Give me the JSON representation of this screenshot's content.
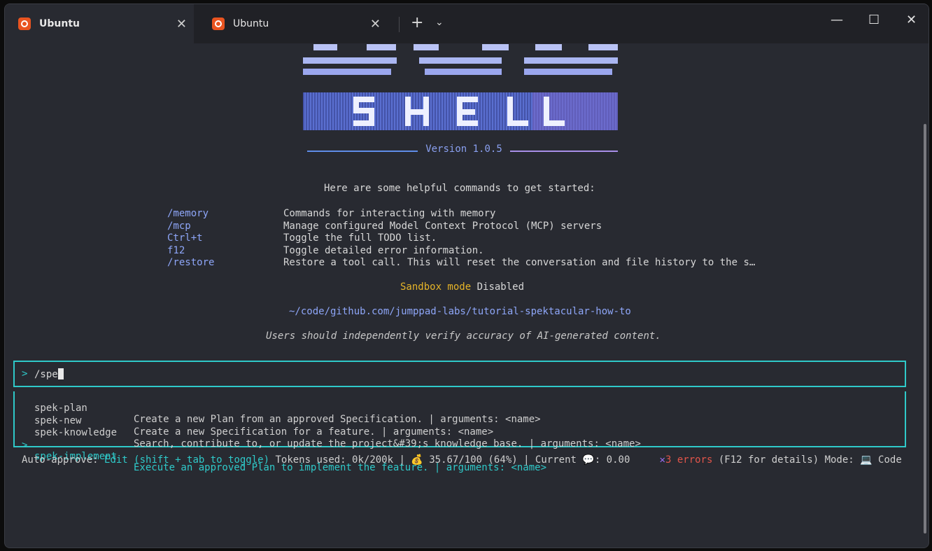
{
  "tabs": [
    {
      "label": "Ubuntu",
      "icon": "ubuntu-icon"
    },
    {
      "label": "Ubuntu",
      "icon": "ubuntu-icon"
    }
  ],
  "window_controls": {
    "new_tab": "+",
    "dropdown": "⌄",
    "minimize": "—",
    "maximize": "☐",
    "close": "✕",
    "tab_close": "✕"
  },
  "banner": {
    "logo_text": "SHELL",
    "version": "Version 1.0.5"
  },
  "helpful_intro": "Here are some helpful commands to get started:",
  "commands": [
    {
      "name": "/memory",
      "desc": "Commands for interacting with memory"
    },
    {
      "name": "/mcp",
      "desc": "Manage configured Model Context Protocol (MCP) servers"
    },
    {
      "name": "Ctrl+t",
      "desc": "Toggle the full TODO list."
    },
    {
      "name": "f12",
      "desc": "Toggle detailed error information."
    },
    {
      "name": "/restore",
      "desc": "Restore a tool call. This will reset the conversation and file history to the s…"
    }
  ],
  "sandbox": {
    "label": "Sandbox mode",
    "value": "Disabled"
  },
  "cwd": "~/code/github.com/jumppad-labs/tutorial-spektacular-how-to",
  "disclaimer": "Users should independently verify accuracy of AI-generated content.",
  "input": {
    "prompt": ">",
    "value": "/spe"
  },
  "suggestions": [
    {
      "name": "spek-plan",
      "desc": "Create a new Plan from an approved Specification. | arguments: <name>",
      "selected": false
    },
    {
      "name": "spek-new",
      "desc": "Create a new Specification for a feature. | arguments: <name>",
      "selected": false
    },
    {
      "name": "spek-knowledge",
      "desc": "Search, contribute to, or update the project&#39;s knowledge base. | arguments: <name>",
      "selected": false
    },
    {
      "name": "spek-implement",
      "desc": "Execute an approved Plan to implement the feature. | arguments: <name>",
      "selected": true
    }
  ],
  "selected_marker": ">",
  "status": {
    "auto_approve_label": "Auto-approve:",
    "auto_approve_value": "Edit (shift + tab to toggle)",
    "tokens": "Tokens used: 0k/200k |",
    "money_icon": "💰",
    "budget": "35.67/100 (64%) | Current",
    "bubble_icon": "💬",
    "current": ": 0.00",
    "error_icon": "✕",
    "errors": "3 errors",
    "errors_hint": "(F12 for details) Mode:",
    "mode_icon": "💻",
    "mode": "Code"
  },
  "colors": {
    "accent": "#2fc9c9",
    "command": "#8ea6f8",
    "warning": "#e6b428",
    "error": "#e2554a"
  }
}
